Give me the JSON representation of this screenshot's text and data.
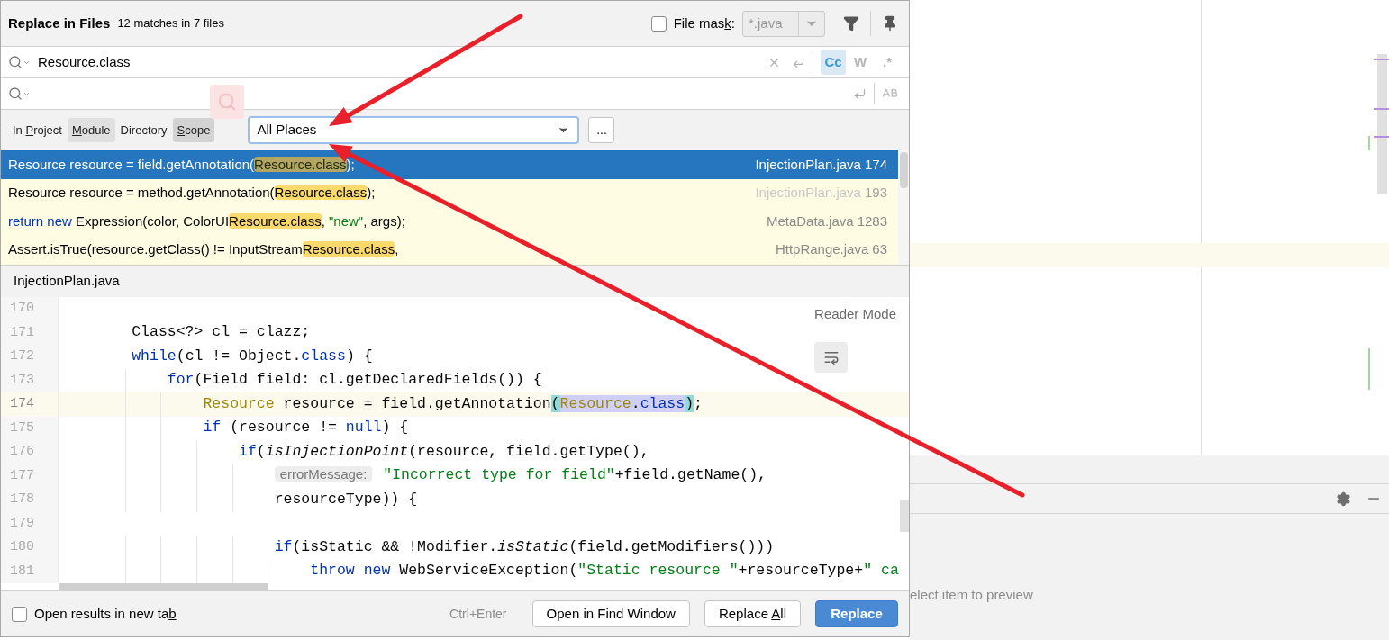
{
  "dialog": {
    "title": "Replace in Files",
    "summary": "12 matches in 7 files"
  },
  "file_mask": {
    "label": [
      {
        "text": "File mas",
        "underlined": false
      },
      {
        "text": "k",
        "underlined": true
      },
      {
        "text": ":",
        "underlined": false
      }
    ],
    "checked": false,
    "value": "*.java",
    "disabled": true
  },
  "search": {
    "value": "Resource.class",
    "options": [
      {
        "label": "Cc",
        "selected": true
      },
      {
        "label": "W",
        "selected": false
      },
      {
        "label": ".*",
        "selected": false
      }
    ]
  },
  "scopes": [
    {
      "label": [
        {
          "text": "In ",
          "underlined": false
        },
        {
          "text": "P",
          "underlined": true
        },
        {
          "text": "roject",
          "underlined": false
        }
      ],
      "selected": false,
      "hovered": false
    },
    {
      "label": [
        {
          "text": "M",
          "underlined": true
        },
        {
          "text": "odule",
          "underlined": false
        }
      ],
      "selected": false,
      "hovered": true
    },
    {
      "label": [
        {
          "text": "Directory",
          "underlined": false
        }
      ],
      "selected": false,
      "hovered": false
    },
    {
      "label": [
        {
          "text": "S",
          "underlined": true
        },
        {
          "text": "cope",
          "underlined": false
        }
      ],
      "selected": true,
      "hovered": false
    }
  ],
  "scope_select": {
    "value": "All Places"
  },
  "more_button": "...",
  "results": [
    {
      "selected": true,
      "dimmed": false,
      "file": "InjectionPlan.java",
      "line": "174",
      "tokens": [
        {
          "text": "Resource resource = field.getAnnotation(",
          "kind": "plain"
        },
        {
          "text": "Resource.class",
          "kind": "match"
        },
        {
          "text": ");",
          "kind": "plain"
        }
      ]
    },
    {
      "selected": false,
      "dimmed": true,
      "file": "InjectionPlan.java",
      "line": "193",
      "tokens": [
        {
          "text": "Resource resource = method.getAnnotation(",
          "kind": "plain"
        },
        {
          "text": "Resource.class",
          "kind": "match"
        },
        {
          "text": ");",
          "kind": "plain"
        }
      ]
    },
    {
      "selected": false,
      "dimmed": false,
      "file": "MetaData.java",
      "line": "1283",
      "tokens": [
        {
          "text": "return new",
          "kind": "keyword"
        },
        {
          "text": " Expression(color, ColorUI",
          "kind": "plain"
        },
        {
          "text": "Resource.class",
          "kind": "match"
        },
        {
          "text": ", ",
          "kind": "plain"
        },
        {
          "text": "\"new\"",
          "kind": "string"
        },
        {
          "text": ", args);",
          "kind": "plain"
        }
      ]
    },
    {
      "selected": false,
      "dimmed": false,
      "file": "HttpRange.java",
      "line": "63",
      "tokens": [
        {
          "text": "Assert.isTrue(resource.getClass() != InputStream",
          "kind": "plain"
        },
        {
          "text": "Resource.class",
          "kind": "match"
        },
        {
          "text": ",",
          "kind": "plain"
        }
      ]
    }
  ],
  "preview": {
    "file": "InjectionPlan.java",
    "reader_mode": "Reader Mode",
    "lines": [
      {
        "number": "170",
        "current": false
      },
      {
        "number": "171",
        "current": false,
        "tokens": [
          {
            "text": "        Class<?> cl = clazz;",
            "kind": "plain"
          }
        ]
      },
      {
        "number": "172",
        "current": false,
        "tokens": [
          {
            "text": "        while",
            "kind": "keyword"
          },
          {
            "text": "(cl != Object.",
            "kind": "plain"
          },
          {
            "text": "class",
            "kind": "keyword"
          },
          {
            "text": ") {",
            "kind": "plain"
          }
        ]
      },
      {
        "number": "173",
        "current": false,
        "tokens": [
          {
            "text": "            for",
            "kind": "keyword"
          },
          {
            "text": "(Field field: cl.getDeclaredFields()) {",
            "kind": "plain"
          }
        ]
      },
      {
        "number": "174",
        "current": true,
        "tokens": [
          {
            "text": "                Resource",
            "kind": "type"
          },
          {
            "text": " resource = field.getAnnotation",
            "kind": "plain"
          },
          {
            "text": "(",
            "kind": "brace"
          },
          {
            "text": "Resource",
            "kind": "match-type"
          },
          {
            "text": ".",
            "kind": "match-plain"
          },
          {
            "text": "class",
            "kind": "match-keyword"
          },
          {
            "text": ")",
            "kind": "brace"
          },
          {
            "text": ";",
            "kind": "plain"
          }
        ]
      },
      {
        "number": "175",
        "current": false,
        "tokens": [
          {
            "text": "                if",
            "kind": "keyword"
          },
          {
            "text": " (resource != ",
            "kind": "plain"
          },
          {
            "text": "null",
            "kind": "keyword"
          },
          {
            "text": ") {",
            "kind": "plain"
          }
        ]
      },
      {
        "number": "176",
        "current": false,
        "tokens": [
          {
            "text": "                    if",
            "kind": "keyword"
          },
          {
            "text": "(",
            "kind": "plain"
          },
          {
            "text": "isInjectionPoint",
            "kind": "italic"
          },
          {
            "text": "(resource, field.getType(),",
            "kind": "plain"
          }
        ]
      },
      {
        "number": "177",
        "current": false,
        "tokens": [
          {
            "text": "                        errorMessage:",
            "kind": "hint"
          },
          {
            "text": " \"Incorrect type for field\"",
            "kind": "string"
          },
          {
            "text": "+field.getName(),",
            "kind": "plain"
          }
        ]
      },
      {
        "number": "178",
        "current": false,
        "tokens": [
          {
            "text": "                        resourceType)) {",
            "kind": "plain"
          }
        ]
      },
      {
        "number": "179",
        "current": false
      },
      {
        "number": "180",
        "current": false,
        "tokens": [
          {
            "text": "                        if",
            "kind": "keyword"
          },
          {
            "text": "(isStatic && !Modifier.",
            "kind": "plain"
          },
          {
            "text": "isStatic",
            "kind": "italic"
          },
          {
            "text": "(field.getModifiers()))",
            "kind": "plain"
          }
        ]
      },
      {
        "number": "181",
        "current": false,
        "tokens": [
          {
            "text": "                            throw new",
            "kind": "keyword"
          },
          {
            "text": " WebServiceException(",
            "kind": "plain"
          },
          {
            "text": "\"Static resource \"",
            "kind": "string"
          },
          {
            "text": "+resourceType+",
            "kind": "plain"
          },
          {
            "text": "\" ca",
            "kind": "string"
          }
        ]
      }
    ]
  },
  "footer": {
    "new_tab": {
      "label": [
        {
          "text": "Open results in new ta",
          "underlined": false
        },
        {
          "text": "b",
          "underlined": true
        }
      ],
      "checked": false
    },
    "shortcut": "Ctrl+Enter",
    "buttons": [
      {
        "label": [
          {
            "text": "Open in Find Window",
            "underlined": false
          }
        ],
        "primary": false
      },
      {
        "label": [
          {
            "text": "Replace ",
            "underlined": false
          },
          {
            "text": "A",
            "underlined": true
          },
          {
            "text": "ll",
            "underlined": false
          }
        ],
        "primary": false
      },
      {
        "label": [
          {
            "text": "Replace",
            "underlined": false
          }
        ],
        "primary": true
      }
    ]
  },
  "background": {
    "preview_hint": "elect item to preview"
  }
}
